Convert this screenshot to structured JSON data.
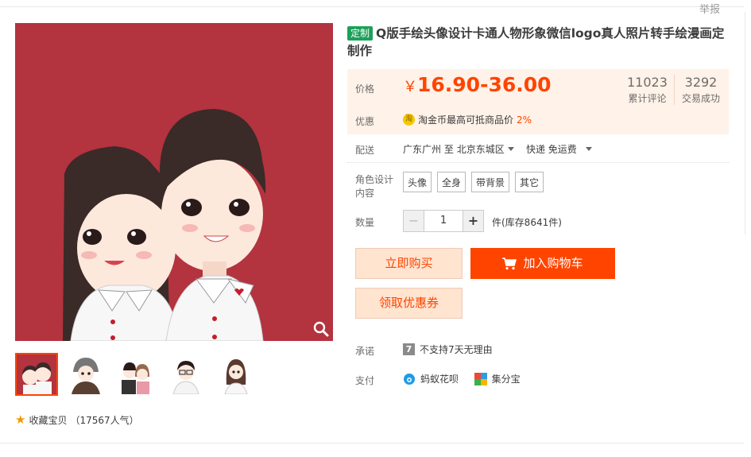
{
  "header": {
    "report": "举报"
  },
  "product": {
    "tag": "定制",
    "title": "Q版手绘头像设计卡通人物形象微信logo真人照片转手绘漫画定制作"
  },
  "price": {
    "label": "价格",
    "currency": "￥",
    "range": "16.90-36.00",
    "reviews_count": "11023",
    "reviews_label": "累计评论",
    "sales_count": "3292",
    "sales_label": "交易成功"
  },
  "discount": {
    "label": "优惠",
    "coin_icon": "淘",
    "text": "淘金币最高可抵商品价",
    "percent": "2%"
  },
  "shipping": {
    "label": "配送",
    "from": "广东广州",
    "to_word": "至",
    "to": "北京东城区",
    "method": "快递 免运费"
  },
  "options": {
    "label": "角色设计内容",
    "items": [
      "头像",
      "全身",
      "带背景",
      "其它"
    ]
  },
  "quantity": {
    "label": "数量",
    "minus": "−",
    "value": "1",
    "plus": "+",
    "stock": "件(库存8641件)"
  },
  "buttons": {
    "buy": "立即购买",
    "cart": "加入购物车",
    "coupon": "领取优惠券"
  },
  "promise": {
    "label": "承诺",
    "icon": "7",
    "text": "不支持7天无理由"
  },
  "payment": {
    "label": "支付",
    "methods": [
      "蚂蚁花呗",
      "集分宝"
    ]
  },
  "favorite": {
    "text": "收藏宝贝",
    "count": "（17567人气）"
  },
  "colors": {
    "accent": "#ff4400",
    "bg_price": "#fff2e8",
    "main_image_bg": "#b3333f",
    "tag": "#1ca05a"
  }
}
